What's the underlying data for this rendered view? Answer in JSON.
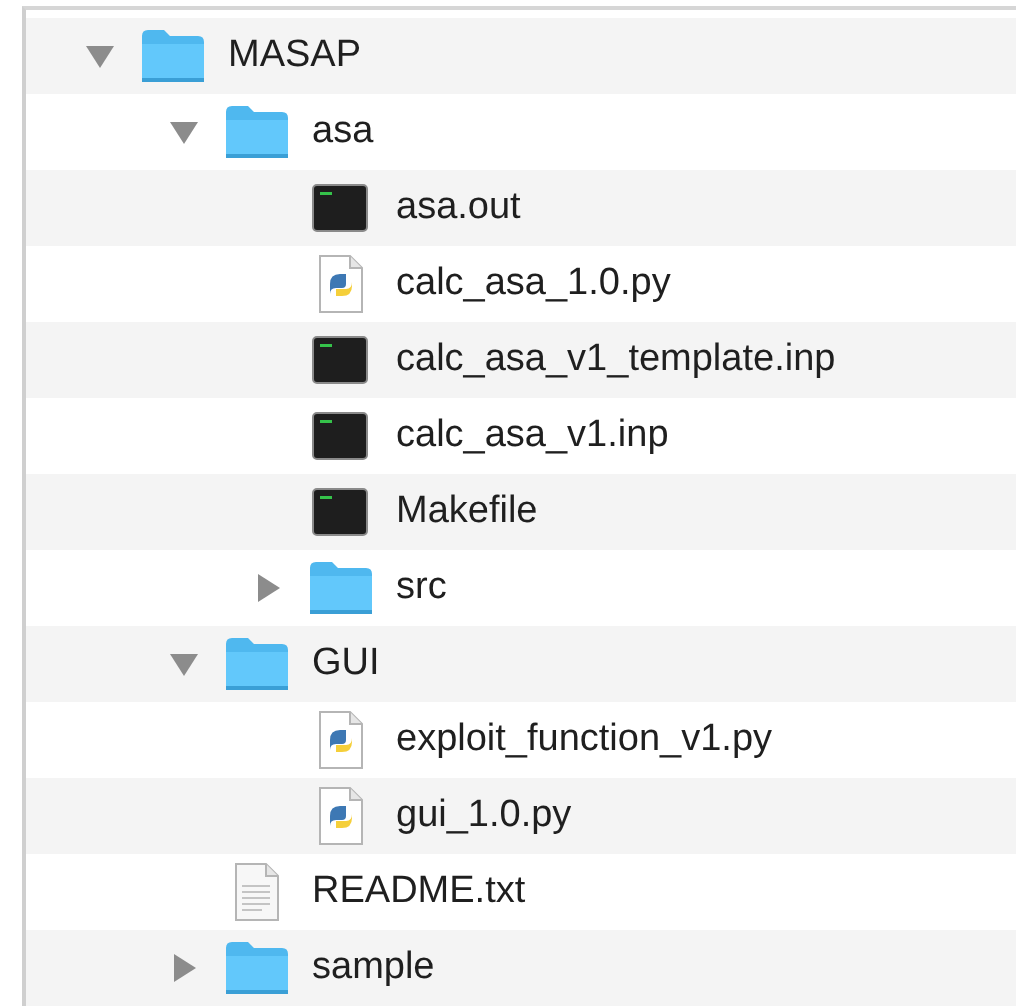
{
  "tree": [
    {
      "name": "MASAP",
      "kind": "folder",
      "expanded": true,
      "children": [
        {
          "name": "asa",
          "kind": "folder",
          "expanded": true,
          "children": [
            {
              "name": "asa.out",
              "kind": "terminal"
            },
            {
              "name": "calc_asa_1.0.py",
              "kind": "python"
            },
            {
              "name": "calc_asa_v1_template.inp",
              "kind": "terminal"
            },
            {
              "name": "calc_asa_v1.inp",
              "kind": "terminal"
            },
            {
              "name": "Makefile",
              "kind": "terminal"
            },
            {
              "name": "src",
              "kind": "folder",
              "expanded": false
            }
          ]
        },
        {
          "name": "GUI",
          "kind": "folder",
          "expanded": true,
          "children": [
            {
              "name": "exploit_function_v1.py",
              "kind": "python"
            },
            {
              "name": "gui_1.0.py",
              "kind": "python"
            }
          ]
        },
        {
          "name": "README.txt",
          "kind": "text"
        },
        {
          "name": "sample",
          "kind": "folder",
          "expanded": false
        }
      ]
    }
  ]
}
